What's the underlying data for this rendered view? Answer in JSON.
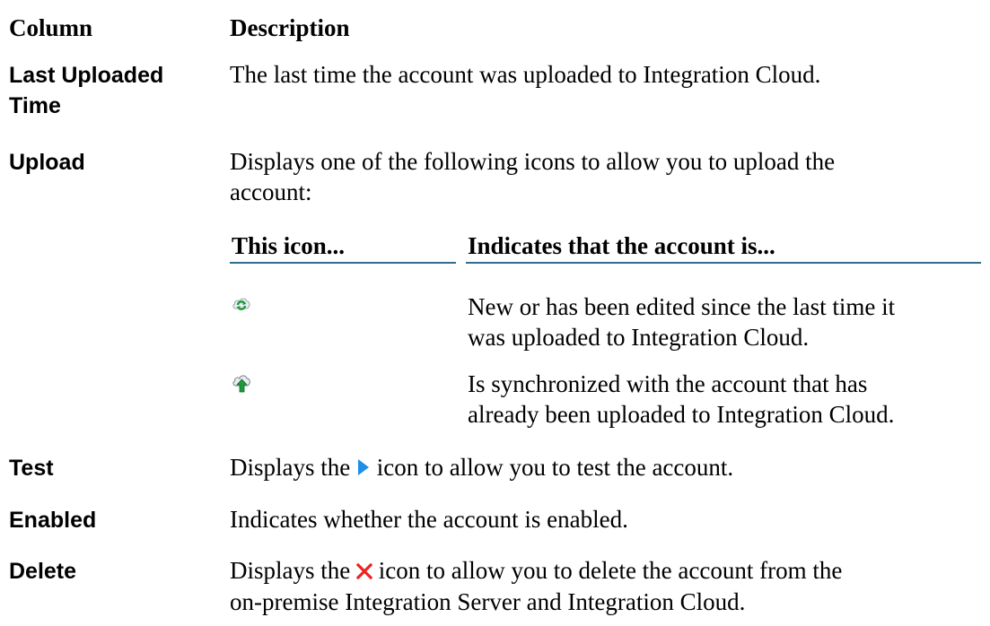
{
  "table": {
    "header": {
      "column": "Column",
      "description": "Description"
    },
    "rows": [
      {
        "name_line1": "Last Uploaded",
        "name_line2": "Time",
        "description": "The last time the account was uploaded to Integration Cloud."
      },
      {
        "name": "Upload",
        "description_line1": "Displays one of the following icons to allow you to upload the",
        "description_line2": "account:"
      },
      {
        "name": "Test",
        "description_before": "Displays the",
        "description_after": "icon to allow you to test the account.",
        "icon": "play-icon"
      },
      {
        "name": "Enabled",
        "description": "Indicates whether the account is enabled."
      },
      {
        "name": "Delete",
        "description_line1_before": "Displays the",
        "description_line1_after": "icon to allow you to delete the account from the",
        "description_line2": "on-premise Integration Server and Integration Cloud.",
        "icon": "delete-x-icon"
      }
    ]
  },
  "subtable": {
    "header": {
      "icon": "This icon...",
      "meaning": "Indicates that the account is..."
    },
    "rows": [
      {
        "icon": "cloud-refresh-icon",
        "line1": "New or has been edited since the last time it",
        "line2": "was uploaded to Integration Cloud."
      },
      {
        "icon": "cloud-upload-icon",
        "line1": "Is synchronized with the account that has",
        "line2": "already been uploaded to Integration Cloud."
      }
    ]
  },
  "colors": {
    "rule": "#2e6d8e",
    "play": "#1e8fe6",
    "delete": "#ee2222",
    "arrow_green": "#1f9a3a"
  }
}
